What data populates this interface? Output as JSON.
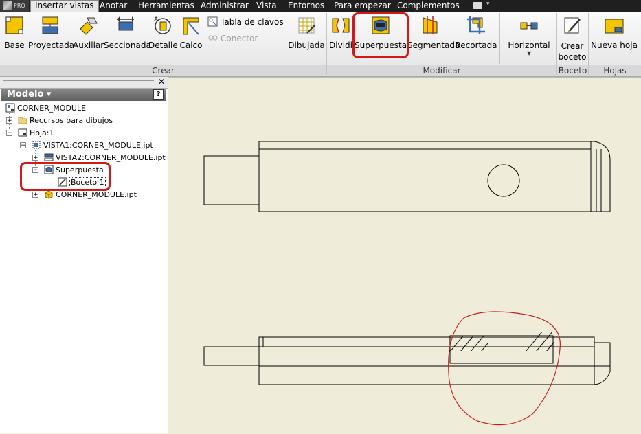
{
  "menu": {
    "app_badge": "PRO",
    "tabs": [
      {
        "label": "Insertar vistas",
        "active": true
      },
      {
        "label": "Anotar"
      },
      {
        "label": "Herramientas"
      },
      {
        "label": "Administrar"
      },
      {
        "label": "Vista"
      },
      {
        "label": "Entornos"
      },
      {
        "label": "Para empezar"
      },
      {
        "label": "Complementos"
      }
    ]
  },
  "ribbon": {
    "crear": {
      "title": "Crear",
      "buttons": {
        "base": "Base",
        "proyectada": "Proyectada",
        "auxiliar": "Auxiliar",
        "seccionada": "Seccionada",
        "detalle": "Detalle",
        "calco": "Calco",
        "tabla_clavos": "Tabla de clavos",
        "conector": "Conector"
      }
    },
    "modificar": {
      "title": "Modificar",
      "buttons": {
        "dibujada": "Dibujada",
        "dividir": "Dividi",
        "superpuesta": "Superpuesta",
        "segmentada": "Segmentada",
        "recortada": "Recortada",
        "horizontal": "Horizontal"
      }
    },
    "boceto": {
      "title": "Boceto",
      "crear_boceto_line1": "Crear",
      "crear_boceto_line2": "boceto"
    },
    "hojas": {
      "title": "Hojas",
      "nueva_hoja": "Nueva hoja"
    }
  },
  "browser": {
    "title": "Modelo",
    "help": "?",
    "tree": {
      "root": "CORNER_MODULE",
      "recursos": "Recursos para dibujos",
      "hoja": "Hoja:1",
      "vista1": "VISTA1:CORNER_MODULE.ipt",
      "vista2": "VISTA2:CORNER_MODULE.ipt",
      "superpuesta": "Superpuesta",
      "boceto": "Boceto 1",
      "part": "CORNER_MODULE.ipt"
    }
  },
  "colors": {
    "highlight": "#d41717",
    "canvas_bg": "#efecd9",
    "sketch_line": "#c82020"
  }
}
